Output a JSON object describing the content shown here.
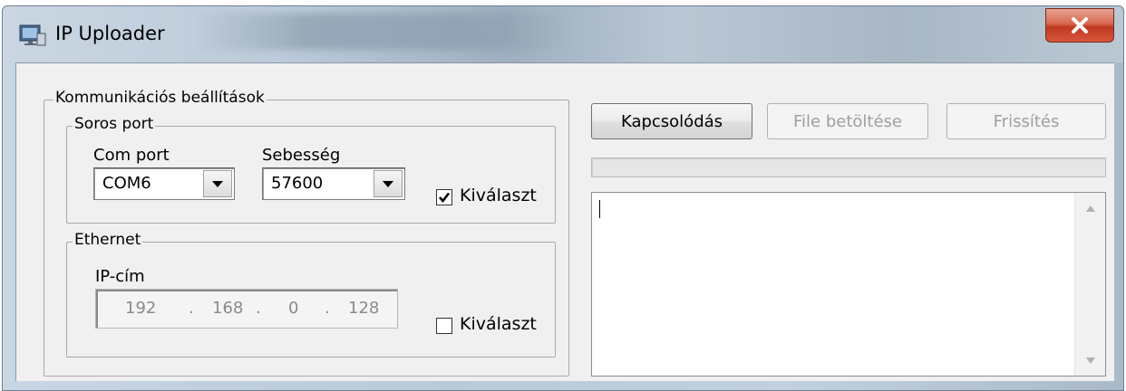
{
  "window": {
    "title": "IP Uploader",
    "icons": {
      "app": "app-icon",
      "close": "close-icon"
    }
  },
  "comm": {
    "legend": "Kommunikációs beállítások",
    "serial": {
      "legend": "Soros port",
      "com_label": "Com port",
      "com_value": "COM6",
      "speed_label": "Sebesség",
      "speed_value": "57600",
      "select_label": "Kiválaszt",
      "selected": true
    },
    "ethernet": {
      "legend": "Ethernet",
      "ip_label": "IP-cím",
      "ip": [
        "192",
        "168",
        "0",
        "128"
      ],
      "ip_sep": ".",
      "select_label": "Kiválaszt",
      "selected": false
    }
  },
  "actions": {
    "connect": "Kapcsolódás",
    "load_file": "File betöltése",
    "refresh": "Frissítés"
  },
  "progress": {
    "value": 0
  },
  "log": {
    "text": ""
  },
  "colors": {
    "close": "#c8462c",
    "disabled_text": "#9f9f9f"
  }
}
